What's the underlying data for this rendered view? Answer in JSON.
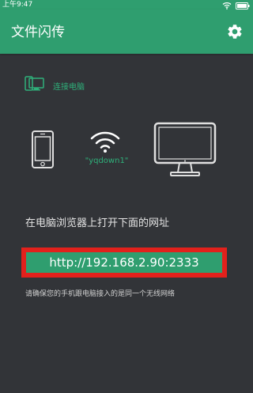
{
  "status_bar": {
    "time": "上午9:47",
    "icons": [
      "wifi-icon",
      "battery-icon"
    ]
  },
  "app_bar": {
    "title": "文件闪传",
    "settings_icon": "gear-icon"
  },
  "connect": {
    "icon": "connect-computer-icon",
    "label": "连接电脑"
  },
  "diagram": {
    "phone_icon": "phone-icon",
    "wifi_icon": "wifi-icon",
    "network_name": "\"yqdown1\"",
    "monitor_icon": "monitor-icon"
  },
  "instruction": "在电脑浏览器上打开下面的网址",
  "url": "http://192.168.2.90:2333",
  "note": "请确保您的手机跟电脑接入的是同一个无线网络",
  "colors": {
    "accent": "#2f9e6f",
    "accent_text": "#2fb07a",
    "background": "#323438",
    "highlight": "#e2211c"
  }
}
